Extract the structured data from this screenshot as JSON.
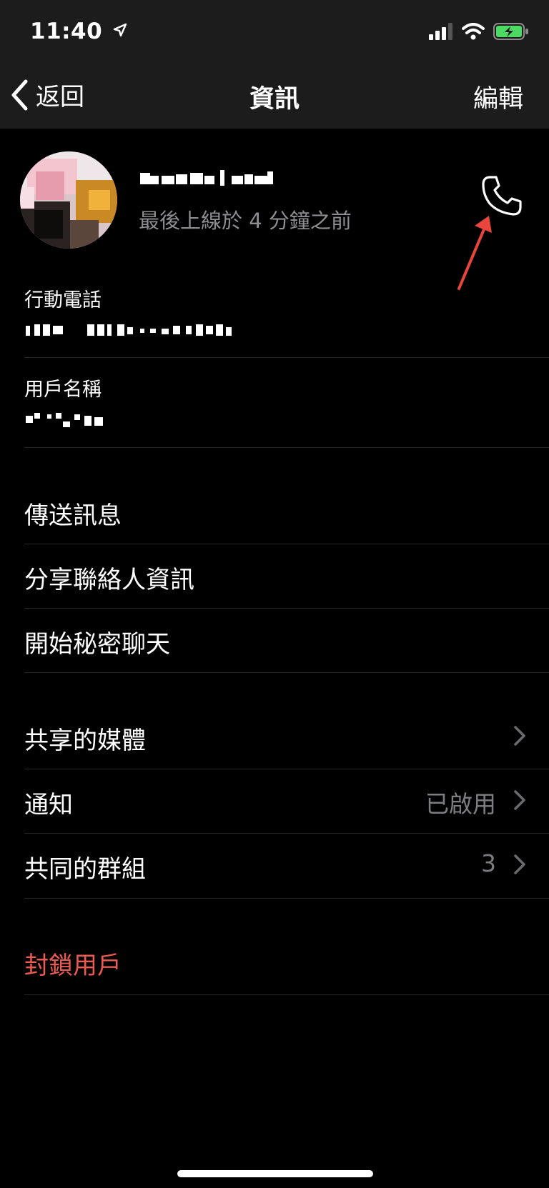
{
  "status_bar": {
    "time": "11:40"
  },
  "nav": {
    "back_label": "返回",
    "title": "資訊",
    "edit_label": "編輯"
  },
  "profile": {
    "name": "Pxxxx Lxxx",
    "last_seen": "最後上線於 4 分鐘之前"
  },
  "fields": [
    {
      "label": "行動電話"
    },
    {
      "label": "用戶名稱"
    }
  ],
  "actions": [
    {
      "label": "傳送訊息"
    },
    {
      "label": "分享聯絡人資訊"
    },
    {
      "label": "開始秘密聊天"
    }
  ],
  "details": [
    {
      "label": "共享的媒體",
      "value": ""
    },
    {
      "label": "通知",
      "value": "已啟用"
    },
    {
      "label": "共同的群組",
      "value": "3"
    }
  ],
  "block": {
    "label": "封鎖用戶"
  },
  "colors": {
    "background": "#000000",
    "topbar": "#1c1c1d",
    "danger": "#ec5a52",
    "battery": "#4cd964",
    "annotation": "#e8453c"
  },
  "icons": [
    "chevron-left-icon",
    "location-arrow-icon",
    "signal-icon",
    "wifi-icon",
    "battery-charging-icon",
    "phone-icon",
    "chevron-right-icon"
  ]
}
